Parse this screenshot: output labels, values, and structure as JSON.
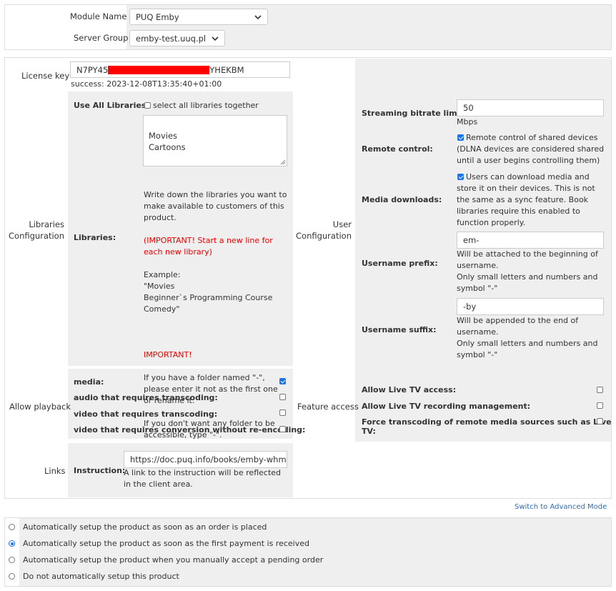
{
  "module": {
    "module_name_label": "Module Name",
    "module_name_value": "PUQ Emby",
    "server_group_label": "Server Group",
    "server_group_value": "emby-test.uuq.pl"
  },
  "license": {
    "label": "License key",
    "value_start": "N7PY45",
    "value_end": "YHEKBM",
    "status": "success: 2023-12-08T13:35:40+01:00"
  },
  "libraries": {
    "section_label": "Libraries Configuration",
    "use_all_label": "Use All Libraries:",
    "use_all_checkbox_label": "select all libraries together",
    "use_all_checked": false,
    "textarea_value": "Movies\nCartoons",
    "libraries_label": "Libraries:",
    "help_1": "Write down the libraries you want to make available to customers of this product.",
    "help_important_1": "(IMPORTANT! Start a new line for each new library)",
    "help_example": "Example:\n\"Movies\nBeginner`s Programming Course\nComedy\"",
    "help_important_2": "IMPORTANT!",
    "help_2": "If you have a folder named \"-\", please enter it not as the first one or rename it.",
    "help_3": "If you don't want any folder to be accessible, type \"-\"."
  },
  "user_config": {
    "section_label": "User Configuration",
    "bitrate_label": "Streaming bitrate limit:",
    "bitrate_value": "50",
    "bitrate_unit": "Mbps",
    "remote_label": "Remote control:",
    "remote_checked": true,
    "remote_text": "Remote control of shared devices (DLNA devices are considered shared until a user begins controlling them)",
    "downloads_label": "Media downloads:",
    "downloads_checked": true,
    "downloads_text": "Users can download media and store it on their devices. This is not the same as a sync feature. Book libraries require this enabled to function properly.",
    "prefix_label": "Username prefix:",
    "prefix_value": "em-",
    "prefix_help_1": "Will be attached to the beginning of username.",
    "prefix_help_2": "Only small letters and numbers and symbol \"-\"",
    "suffix_label": "Username suffix:",
    "suffix_value": "-by",
    "suffix_help_1": "Will be appended to the end of username.",
    "suffix_help_2": "Only small letters and numbers and symbol \"-\""
  },
  "playback": {
    "section_label": "Allow playback",
    "items": [
      {
        "label": "media:",
        "checked": true
      },
      {
        "label": "audio that requires transcoding:",
        "checked": false
      },
      {
        "label": "video that requires transcoding:",
        "checked": false
      },
      {
        "label": "video that requires conversion without re-encoding:",
        "checked": false
      }
    ]
  },
  "features": {
    "section_label": "Feature access",
    "items": [
      {
        "label": "Allow Live TV access:",
        "checked": false
      },
      {
        "label": "Allow Live TV recording management:",
        "checked": false
      },
      {
        "label": "Force transcoding of remote media sources such as Live TV:",
        "checked": false
      }
    ]
  },
  "links": {
    "section_label": "Links",
    "instruction_label": "Instruction:",
    "instruction_value": "https://doc.puq.info/books/emby-whmcs",
    "instruction_help": "A link to the instruction will be reflected in the client area."
  },
  "advanced_link": "Switch to Advanced Mode",
  "setup_options": [
    {
      "label": "Automatically setup the product as soon as an order is placed",
      "selected": false
    },
    {
      "label": "Automatically setup the product as soon as the first payment is received",
      "selected": true
    },
    {
      "label": "Automatically setup the product when you manually accept a pending order",
      "selected": false
    },
    {
      "label": "Do not automatically setup this product",
      "selected": false
    }
  ],
  "colors": {
    "accent": "#1a73e8",
    "redaction": "#ff0000",
    "important": "#e00000",
    "link": "#2a6ebb"
  }
}
